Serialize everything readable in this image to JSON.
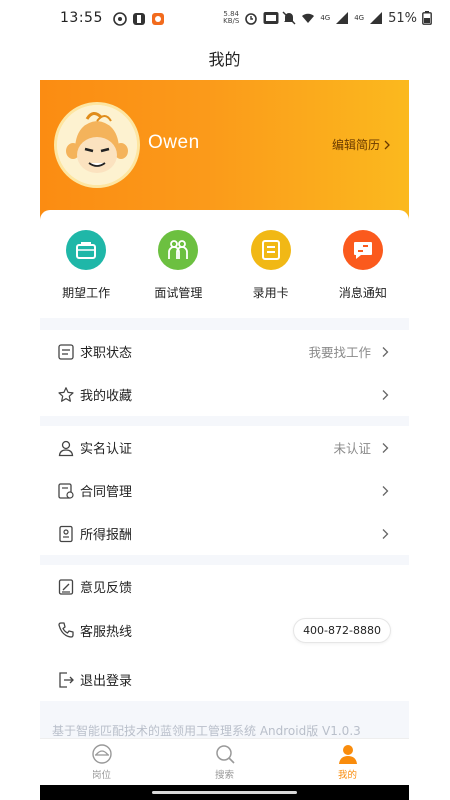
{
  "status_bar": {
    "time": "13:55",
    "net_speed_value": "5.84",
    "net_speed_unit": "KB/S",
    "signal_label_1": "4G",
    "signal_label_2": "4G",
    "battery": "51%"
  },
  "header": {
    "title": "我的"
  },
  "profile": {
    "username": "Owen",
    "edit_resume_label": "编辑简历"
  },
  "quick_actions": [
    {
      "label": "期望工作",
      "icon": "briefcase-icon",
      "color": "#1fb7a8"
    },
    {
      "label": "面试管理",
      "icon": "people-icon",
      "color": "#6cc040"
    },
    {
      "label": "录用卡",
      "icon": "card-icon",
      "color": "#f1b815"
    },
    {
      "label": "消息通知",
      "icon": "message-icon",
      "color": "#fb5a1d"
    }
  ],
  "menu": {
    "job_status": {
      "label": "求职状态",
      "value": "我要找工作"
    },
    "favorites": {
      "label": "我的收藏"
    },
    "real_name": {
      "label": "实名认证",
      "value": "未认证"
    },
    "contracts": {
      "label": "合同管理"
    },
    "earnings": {
      "label": "所得报酬"
    },
    "feedback": {
      "label": "意见反馈"
    },
    "hotline": {
      "label": "客服热线",
      "value": "400-872-8880"
    },
    "logout": {
      "label": "退出登录"
    }
  },
  "footer": {
    "text": "基于智能匹配技术的蓝领用工管理系统 Android版 V1.0.3"
  },
  "tabs": [
    {
      "label": "岗位",
      "icon": "post-icon",
      "active": false
    },
    {
      "label": "搜索",
      "icon": "search-icon",
      "active": false
    },
    {
      "label": "我的",
      "icon": "profile-icon",
      "active": true
    }
  ],
  "colors": {
    "accent": "#f98c0c",
    "hero_start": "#fb8c12",
    "hero_end": "#fbb91e"
  }
}
